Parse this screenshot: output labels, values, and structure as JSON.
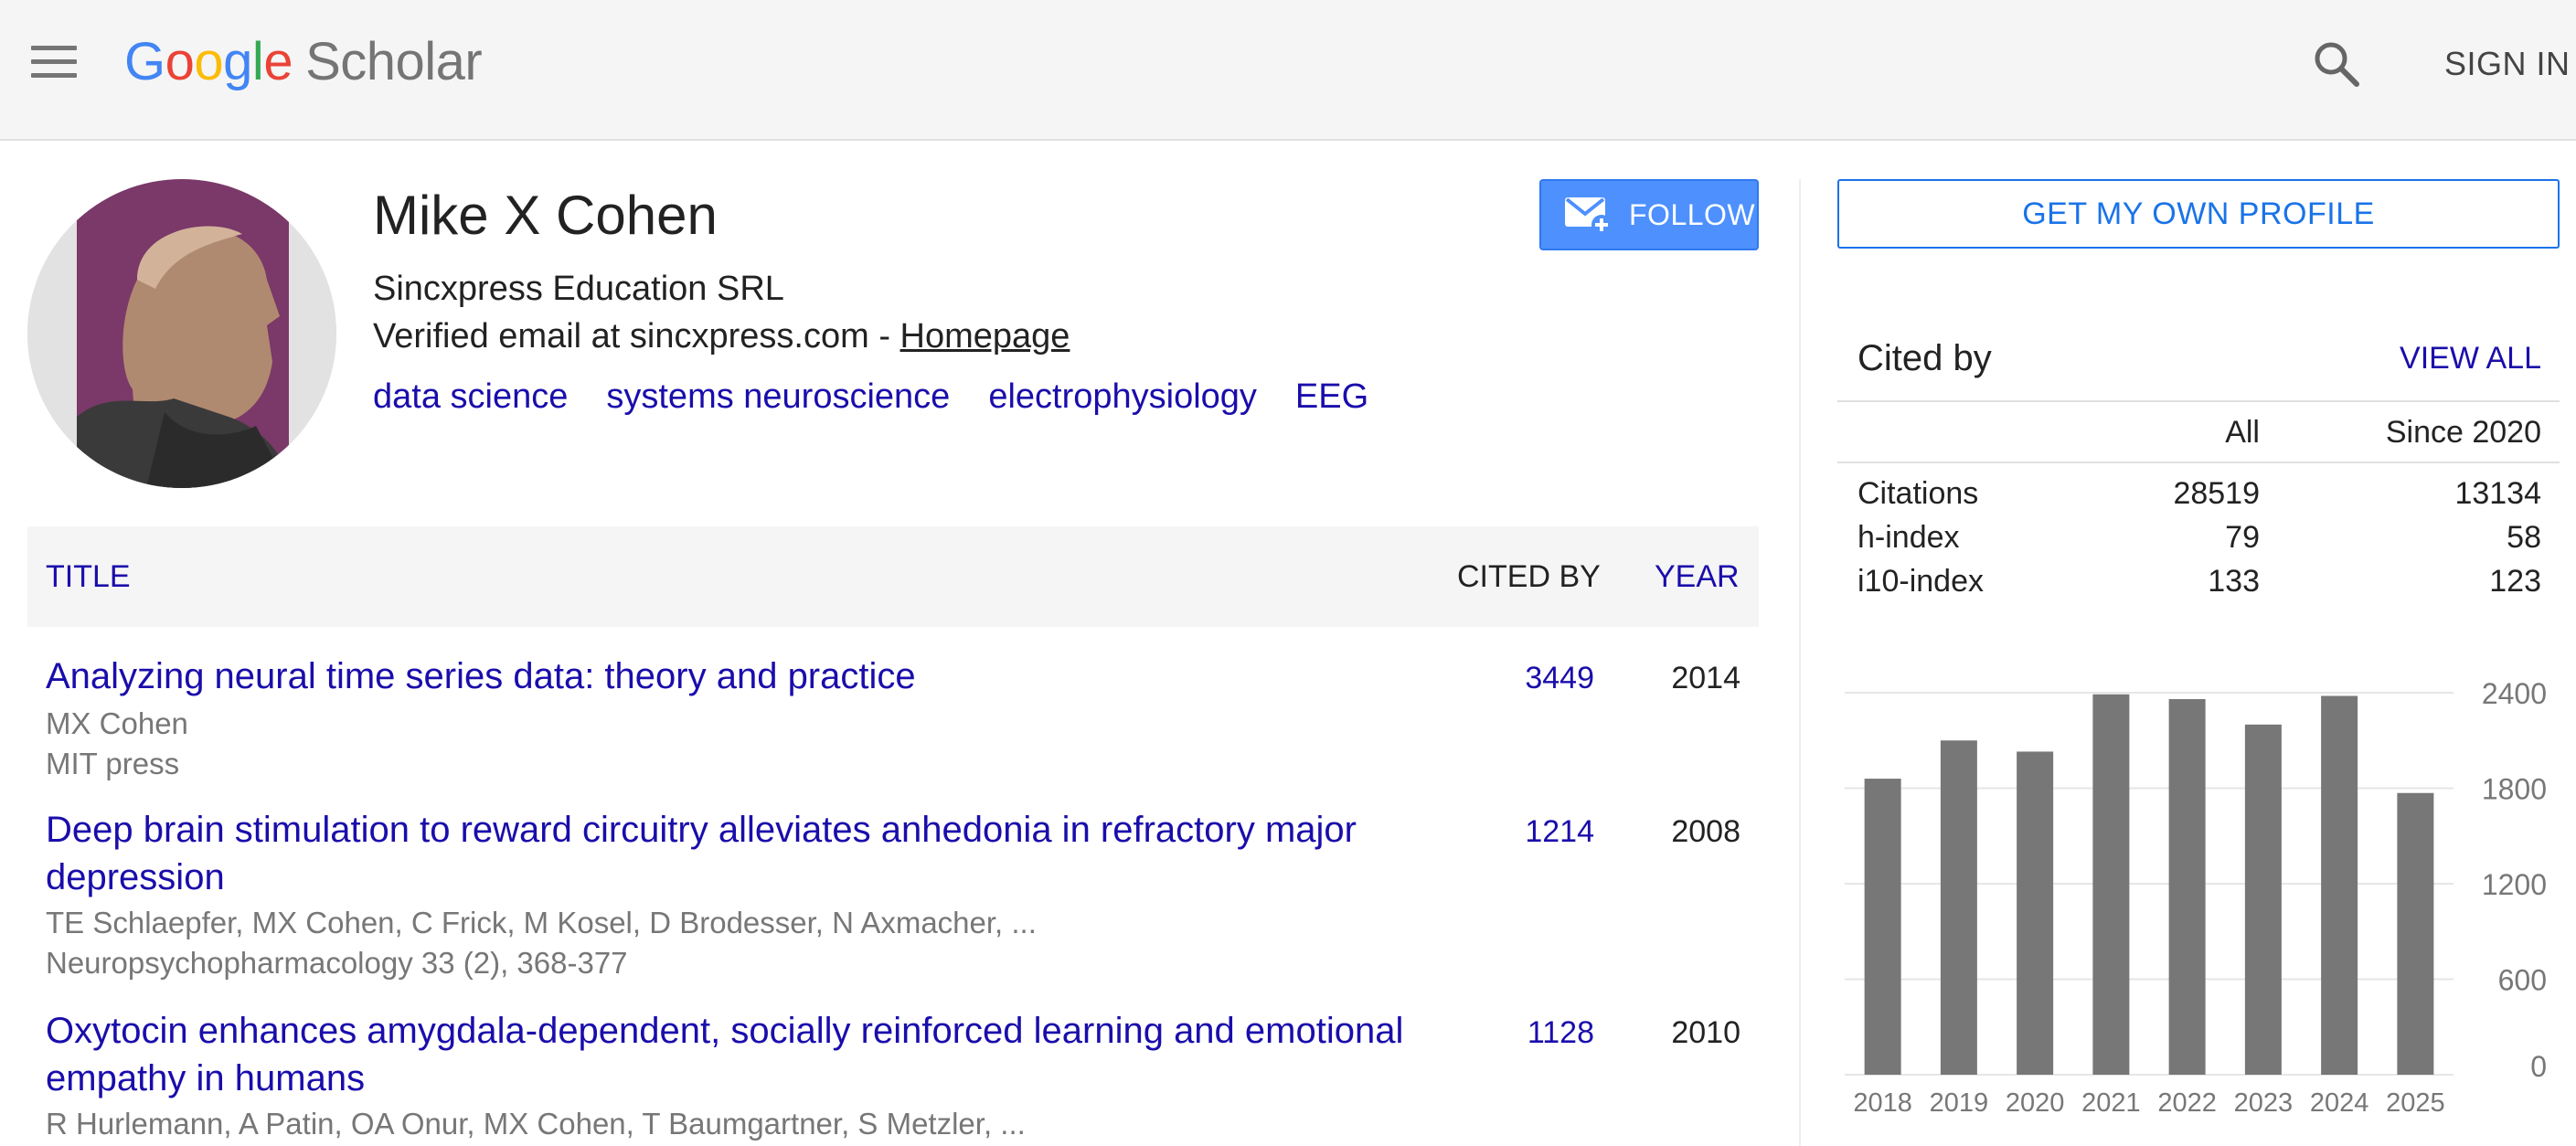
{
  "header": {
    "logo": {
      "google_letters": [
        "G",
        "o",
        "o",
        "g",
        "l",
        "e"
      ],
      "google_colors": [
        "#4285f4",
        "#ea4335",
        "#fbbc05",
        "#4285f4",
        "#34a853",
        "#ea4335"
      ],
      "product": "Scholar"
    },
    "menu_icon": "hamburger-menu-icon",
    "search_icon": "search-icon",
    "sign_in": "SIGN IN"
  },
  "profile": {
    "name": "Mike X Cohen",
    "affiliation": "Sincxpress Education SRL",
    "email_prefix": "Verified email at sincxpress.com - ",
    "homepage_label": "Homepage",
    "interests": [
      "data science",
      "systems neuroscience",
      "electrophysiology",
      "EEG"
    ],
    "follow_label": "FOLLOW",
    "follow_icon": "mail-plus-icon"
  },
  "table": {
    "headers": {
      "title": "TITLE",
      "cited_by": "CITED BY",
      "year": "YEAR"
    },
    "rows": [
      {
        "title": "Analyzing neural time series data: theory and practice",
        "authors": "MX Cohen",
        "venue": "MIT press",
        "cited_by": "3449",
        "year": "2014"
      },
      {
        "title": "Deep brain stimulation to reward circuitry alleviates anhedonia in refractory major depression",
        "authors": "TE Schlaepfer, MX Cohen, C Frick, M Kosel, D Brodesser, N Axmacher, ...",
        "venue": "Neuropsychopharmacology 33 (2), 368-377",
        "cited_by": "1214",
        "year": "2008"
      },
      {
        "title": "Oxytocin enhances amygdala-dependent, socially reinforced learning and emotional empathy in humans",
        "authors": "R Hurlemann, A Patin, OA Onur, MX Cohen, T Baumgartner, S Metzler, ...",
        "venue": "",
        "cited_by": "1128",
        "year": "2010"
      }
    ]
  },
  "sidebar": {
    "own_profile_label": "GET MY OWN PROFILE",
    "cited_by_heading": "Cited by",
    "view_all_label": "VIEW ALL",
    "columns": {
      "all": "All",
      "since": "Since 2020"
    },
    "stats": [
      {
        "label": "Citations",
        "all": "28519",
        "since": "13134"
      },
      {
        "label": "h-index",
        "all": "79",
        "since": "58"
      },
      {
        "label": "i10-index",
        "all": "133",
        "since": "123"
      }
    ]
  },
  "colors": {
    "link": "#1a0dab",
    "follow_bg": "#4d90fe",
    "bar": "#777777",
    "header_bg": "#f5f5f5"
  },
  "chart_data": {
    "type": "bar",
    "categories": [
      "2018",
      "2019",
      "2020",
      "2021",
      "2022",
      "2023",
      "2024",
      "2025"
    ],
    "values": [
      1860,
      2100,
      2030,
      2390,
      2360,
      2200,
      2380,
      1770
    ],
    "yticks": [
      0,
      600,
      1200,
      1800,
      2400
    ],
    "ylim": [
      0,
      2400
    ],
    "grid": true,
    "y_axis_side": "right",
    "xlabel": "",
    "ylabel": ""
  }
}
